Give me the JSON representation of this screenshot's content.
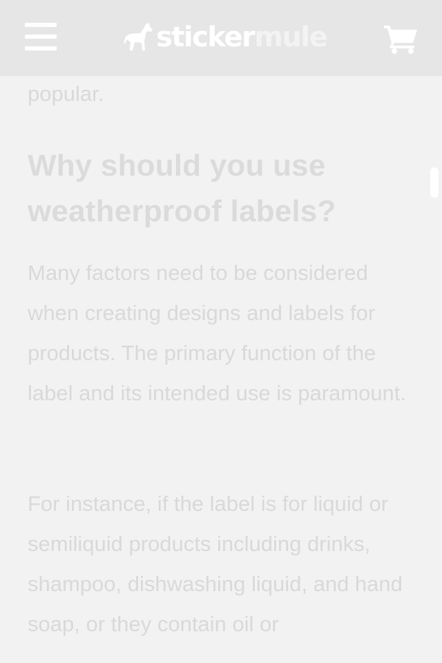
{
  "header": {
    "logo": {
      "part1": "sticker",
      "part2": "mule"
    }
  },
  "article": {
    "fragment": "popular.",
    "heading": "Why should you use weatherproof labels?",
    "paragraph1": "Many factors need to be considered when creating designs and labels for products. The primary function of the label and its intended use is paramount.",
    "paragraph2": "For instance, if the label is for liquid or semiliquid products including drinks, shampoo, dishwashing liquid, and hand soap, or they contain oil or"
  },
  "colors": {
    "header_bg": "#e6e6e6",
    "page_bg": "#f2f2f2",
    "text": "#d9d9d9",
    "icon": "#ffffff"
  },
  "icons": {
    "menu": "hamburger-menu-icon",
    "logo": "mule-logo-icon",
    "cart": "shopping-cart-icon"
  }
}
